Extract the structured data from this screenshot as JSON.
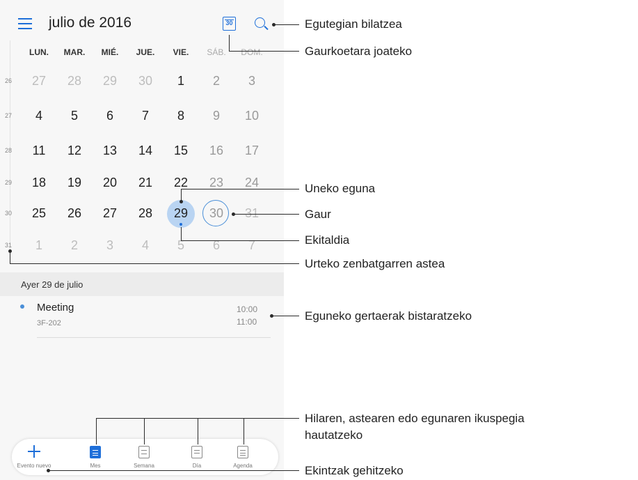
{
  "header": {
    "title": "julio de 2016",
    "today_badge": "30"
  },
  "weekdays": [
    "LUN.",
    "MAR.",
    "MIÉ.",
    "JUE.",
    "VIE.",
    "SÁB.",
    "DOM."
  ],
  "weeks": [
    {
      "num": "26",
      "days": [
        "27",
        "28",
        "29",
        "30",
        "1",
        "2",
        "3"
      ]
    },
    {
      "num": "27",
      "days": [
        "4",
        "5",
        "6",
        "7",
        "8",
        "9",
        "10"
      ]
    },
    {
      "num": "28",
      "days": [
        "11",
        "12",
        "13",
        "14",
        "15",
        "16",
        "17"
      ]
    },
    {
      "num": "29",
      "days": [
        "18",
        "19",
        "20",
        "21",
        "22",
        "23",
        "24"
      ]
    },
    {
      "num": "30",
      "days": [
        "25",
        "26",
        "27",
        "28",
        "29",
        "30",
        "31"
      ]
    },
    {
      "num": "31",
      "days": [
        "1",
        "2",
        "3",
        "4",
        "5",
        "6",
        "7"
      ]
    }
  ],
  "events": {
    "date_header": "Ayer 29 de julio",
    "items": [
      {
        "title": "Meeting",
        "location": "3F-202",
        "start": "10:00",
        "end": "11:00"
      }
    ]
  },
  "bottom_nav": {
    "new_event": "Evento nuevo",
    "month": "Mes",
    "week": "Semana",
    "day": "Día",
    "agenda": "Agenda"
  },
  "annotations": {
    "search": "Egutegian bilatzea",
    "go_today": "Gaurkoetara joateko",
    "current_day": "Uneko eguna",
    "today": "Gaur",
    "event": "Ekitaldia",
    "week_number": "Urteko zenbatgarren astea",
    "day_events": "Eguneko gertaerak bistaratzeko",
    "view_select": "Hilaren, astearen edo egunaren ikuspegia hautatzeko",
    "add_actions": "Ekintzak gehitzeko"
  },
  "colors": {
    "accent": "#1e6fd9",
    "selected_day_bg": "#b9d4f2"
  }
}
